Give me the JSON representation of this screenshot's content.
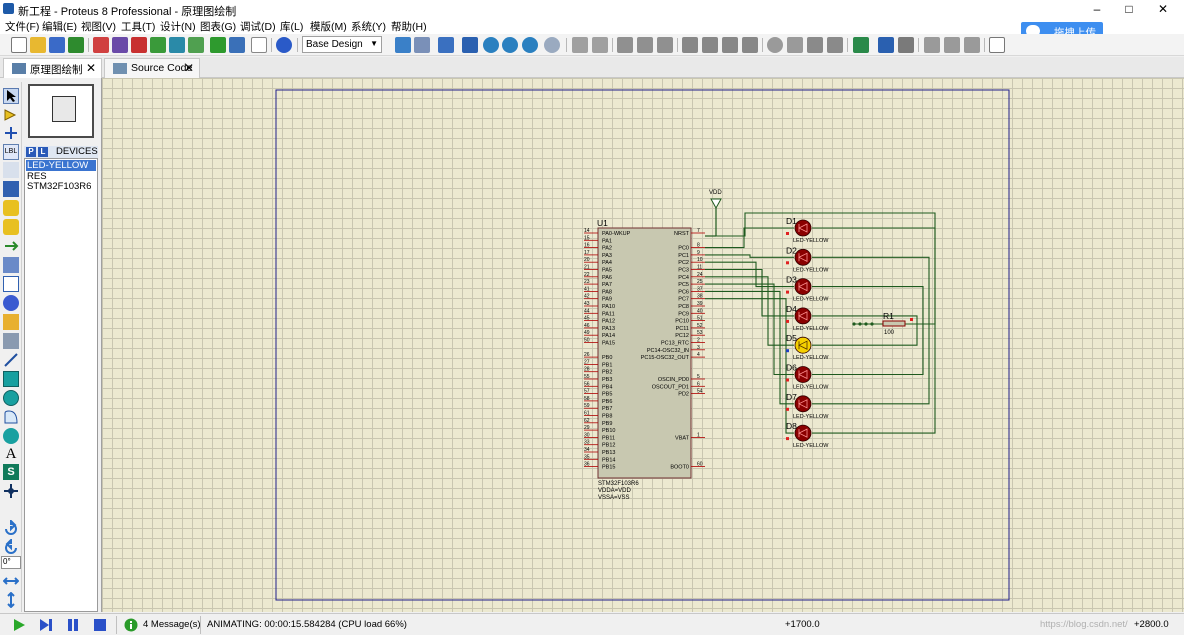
{
  "window": {
    "title": "新工程 - Proteus 8 Professional - 原理图绘制",
    "controls": [
      "minimize",
      "maximize",
      "close"
    ]
  },
  "menu": [
    "文件(F)",
    "编辑(E)",
    "视图(V)",
    "工具(T)",
    "设计(N)",
    "图表(G)",
    "调试(D)",
    "库(L)",
    "模版(M)",
    "系统(Y)",
    "帮助(H)"
  ],
  "upload_button": "拖拽上传",
  "toolbar": {
    "design_select": "Base Design"
  },
  "tabs": [
    {
      "label": "原理图绘制",
      "active": true
    },
    {
      "label": "Source Code",
      "active": false
    }
  ],
  "devices_panel": {
    "p_label": "P",
    "l_label": "L",
    "header": "DEVICES",
    "items": [
      "LED-YELLOW",
      "RES",
      "STM32F103R6"
    ],
    "selected": "LED-YELLOW"
  },
  "rotation": "0°",
  "schematic": {
    "mcu": {
      "ref": "U1",
      "part": "STM32F103R6",
      "power_notes": [
        "VDDA=VDD",
        "VSSA=VSS"
      ],
      "left_pins": [
        {
          "num": "14",
          "name": "PA0-WKUP"
        },
        {
          "num": "15",
          "name": "PA1"
        },
        {
          "num": "16",
          "name": "PA2"
        },
        {
          "num": "17",
          "name": "PA3"
        },
        {
          "num": "20",
          "name": "PA4"
        },
        {
          "num": "21",
          "name": "PA5"
        },
        {
          "num": "22",
          "name": "PA6"
        },
        {
          "num": "23",
          "name": "PA7"
        },
        {
          "num": "41",
          "name": "PA8"
        },
        {
          "num": "42",
          "name": "PA9"
        },
        {
          "num": "43",
          "name": "PA10"
        },
        {
          "num": "44",
          "name": "PA11"
        },
        {
          "num": "45",
          "name": "PA12"
        },
        {
          "num": "46",
          "name": "PA13"
        },
        {
          "num": "49",
          "name": "PA14"
        },
        {
          "num": "50",
          "name": "PA15"
        },
        {
          "num": "",
          "name": ""
        },
        {
          "num": "26",
          "name": "PB0"
        },
        {
          "num": "27",
          "name": "PB1"
        },
        {
          "num": "28",
          "name": "PB2"
        },
        {
          "num": "55",
          "name": "PB3"
        },
        {
          "num": "56",
          "name": "PB4"
        },
        {
          "num": "57",
          "name": "PB5"
        },
        {
          "num": "58",
          "name": "PB6"
        },
        {
          "num": "59",
          "name": "PB7"
        },
        {
          "num": "61",
          "name": "PB8"
        },
        {
          "num": "62",
          "name": "PB9"
        },
        {
          "num": "29",
          "name": "PB10"
        },
        {
          "num": "30",
          "name": "PB11"
        },
        {
          "num": "33",
          "name": "PB12"
        },
        {
          "num": "34",
          "name": "PB13"
        },
        {
          "num": "35",
          "name": "PB14"
        },
        {
          "num": "36",
          "name": "PB15"
        }
      ],
      "right_pins": [
        {
          "num": "7",
          "name": "NRST",
          "row": 0
        },
        {
          "num": "8",
          "name": "PC0",
          "row": 2
        },
        {
          "num": "9",
          "name": "PC1",
          "row": 3
        },
        {
          "num": "10",
          "name": "PC2",
          "row": 4
        },
        {
          "num": "11",
          "name": "PC3",
          "row": 5
        },
        {
          "num": "24",
          "name": "PC4",
          "row": 6
        },
        {
          "num": "25",
          "name": "PC5",
          "row": 7
        },
        {
          "num": "37",
          "name": "PC6",
          "row": 8
        },
        {
          "num": "38",
          "name": "PC7",
          "row": 9
        },
        {
          "num": "39",
          "name": "PC8",
          "row": 10
        },
        {
          "num": "40",
          "name": "PC9",
          "row": 11
        },
        {
          "num": "51",
          "name": "PC10",
          "row": 12
        },
        {
          "num": "52",
          "name": "PC11",
          "row": 13
        },
        {
          "num": "53",
          "name": "PC12",
          "row": 14
        },
        {
          "num": "2",
          "name": "PC13_RTC",
          "row": 15
        },
        {
          "num": "3",
          "name": "PC14-OSC32_IN",
          "row": 16
        },
        {
          "num": "4",
          "name": "PC15-OSC32_OUT",
          "row": 17
        },
        {
          "num": "5",
          "name": "OSCIN_PD0",
          "row": 20
        },
        {
          "num": "6",
          "name": "OSCOUT_PD1",
          "row": 21
        },
        {
          "num": "54",
          "name": "PD2",
          "row": 22
        },
        {
          "num": "1",
          "name": "VBAT",
          "row": 28
        },
        {
          "num": "60",
          "name": "BOOT0",
          "row": 32
        }
      ]
    },
    "vdd_label": "VDD",
    "leds": [
      {
        "ref": "D1",
        "value": "LED-YELLOW",
        "lit": false
      },
      {
        "ref": "D2",
        "value": "LED-YELLOW",
        "lit": false
      },
      {
        "ref": "D3",
        "value": "LED-YELLOW",
        "lit": false
      },
      {
        "ref": "D4",
        "value": "LED-YELLOW",
        "lit": false
      },
      {
        "ref": "D5",
        "value": "LED-YELLOW",
        "lit": true
      },
      {
        "ref": "D6",
        "value": "LED-YELLOW",
        "lit": false
      },
      {
        "ref": "D7",
        "value": "LED-YELLOW",
        "lit": false
      },
      {
        "ref": "D8",
        "value": "LED-YELLOW",
        "lit": false
      }
    ],
    "resistor": {
      "ref": "R1",
      "value": "100"
    }
  },
  "status": {
    "messages": "4 Message(s)",
    "animating": "ANIMATING: 00:00:15.584284 (CPU load 66%)",
    "coord_x": "+1700.0",
    "coord_y": "+2800.0",
    "watermark": "https://blog.csdn.net/"
  },
  "colors": {
    "wire": "#1e5a1e",
    "pin_red": "#b00000",
    "led_off": "#8a0000",
    "led_on": "#f5d000",
    "sheet_border": "#20208a",
    "chip_fill": "#c8c8b0",
    "canvas": "#ece9d0"
  }
}
